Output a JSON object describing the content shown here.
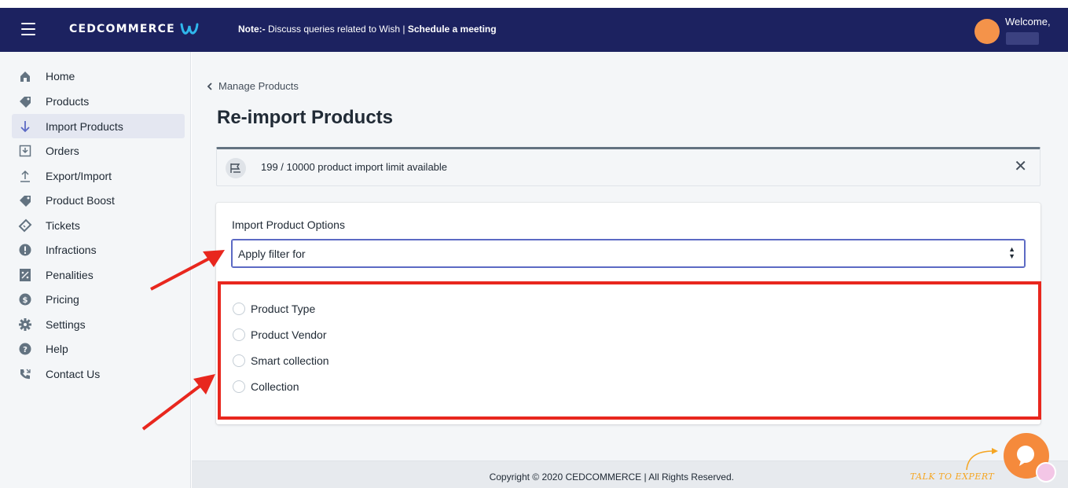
{
  "topbar": {
    "logo_text": "CEDCOMMERCE",
    "note_prefix": "Note:-",
    "note_text": " Discuss queries related to Wish | ",
    "note_link": "Schedule a meeting",
    "welcome": "Welcome,",
    "avatar_color": "#f4934a",
    "brand_color": "#1c2260"
  },
  "sidebar": {
    "items": [
      {
        "label": "Home",
        "icon": "home-icon",
        "active": false
      },
      {
        "label": "Products",
        "icon": "tag-icon",
        "active": false
      },
      {
        "label": "Import Products",
        "icon": "arrow-down-icon",
        "active": true
      },
      {
        "label": "Orders",
        "icon": "inbox-download-icon",
        "active": false
      },
      {
        "label": "Export/Import",
        "icon": "upload-icon",
        "active": false
      },
      {
        "label": "Product Boost",
        "icon": "tag-icon",
        "active": false
      },
      {
        "label": "Tickets",
        "icon": "ticket-icon",
        "active": false
      },
      {
        "label": "Infractions",
        "icon": "alert-icon",
        "active": false
      },
      {
        "label": "Penalities",
        "icon": "percent-icon",
        "active": false
      },
      {
        "label": "Pricing",
        "icon": "dollar-icon",
        "active": false
      },
      {
        "label": "Settings",
        "icon": "gear-icon",
        "active": false
      },
      {
        "label": "Help",
        "icon": "question-icon",
        "active": false
      },
      {
        "label": "Contact Us",
        "icon": "phone-icon",
        "active": false
      }
    ]
  },
  "main": {
    "breadcrumb": "Manage Products",
    "title": "Re-import Products",
    "banner_text": "199 / 10000 product import limit available",
    "card": {
      "label": "Import Product Options",
      "select_value": "Apply filter for",
      "options": [
        {
          "label": "Product Type"
        },
        {
          "label": "Product Vendor"
        },
        {
          "label": "Smart collection"
        },
        {
          "label": "Collection"
        }
      ]
    }
  },
  "footer": {
    "copyright": "Copyright © 2020 CEDCOMMERCE | All Rights Reserved."
  },
  "widget": {
    "talk_label": "TALK TO EXPERT",
    "accent": "#f58a3c"
  },
  "annotation_color": "#e8271e"
}
